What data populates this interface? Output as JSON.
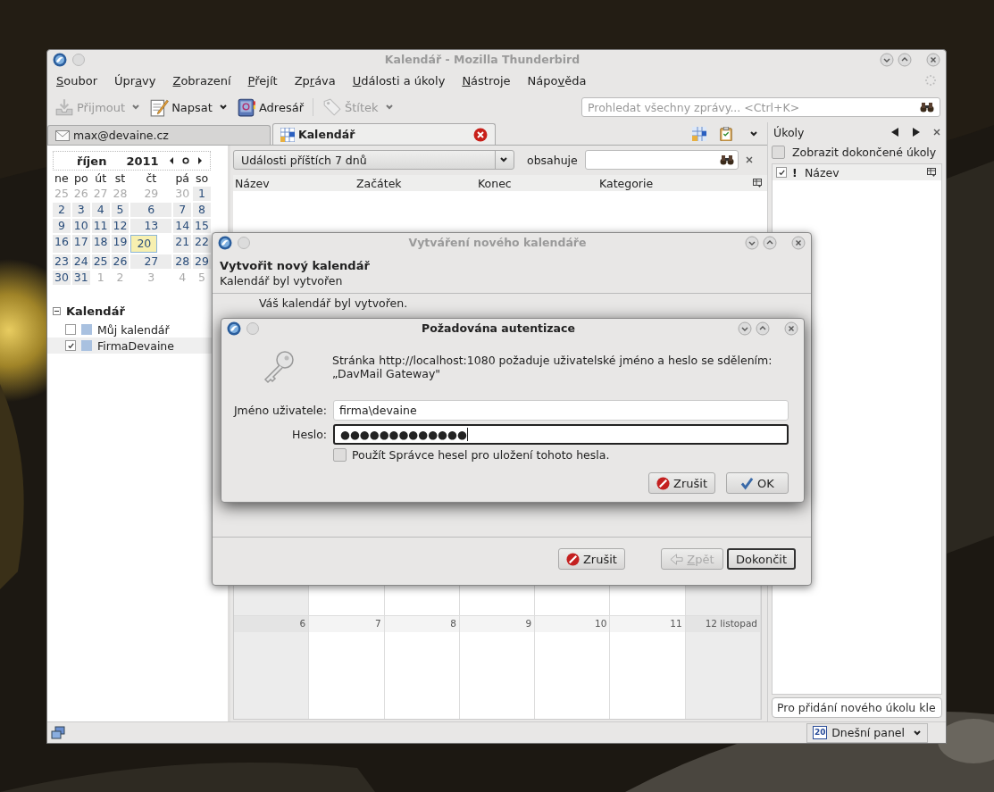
{
  "main_window": {
    "title": "Kalendář - Mozilla Thunderbird",
    "menu": [
      {
        "key": "S",
        "post": "oubor"
      },
      {
        "pre": "Úpr",
        "key": "a",
        "post": "vy"
      },
      {
        "key": "Z",
        "post": "obrazení"
      },
      {
        "key": "P",
        "post": "řejít"
      },
      {
        "pre": "Zp",
        "key": "r",
        "post": "áva"
      },
      {
        "key": "U",
        "post": "dálosti a úkoly"
      },
      {
        "key": "N",
        "post": "ástroje"
      },
      {
        "pre": "Nápo",
        "key": "v",
        "post": "ěda"
      }
    ],
    "toolbar": [
      {
        "label": "Přijmout",
        "kind": "inbox",
        "disabled": true,
        "dropdown": true
      },
      {
        "label": "Napsat",
        "kind": "compose",
        "disabled": false,
        "dropdown": true
      },
      {
        "label": "Adresář",
        "kind": "addressbook",
        "disabled": false,
        "dropdown": false
      },
      {
        "label": "Štítek",
        "kind": "tag",
        "disabled": true,
        "dropdown": true
      }
    ],
    "search": {
      "placeholder": "Prohledat všechny zprávy... <Ctrl+K>"
    },
    "tabs": [
      {
        "label": "max@devaine.cz",
        "kind": "mail",
        "selected": false,
        "closable": false
      },
      {
        "label": "Kalendář",
        "kind": "calendar",
        "selected": true,
        "closable": true
      }
    ],
    "filter": {
      "value": "Události příštích 7 dnů",
      "contains_label": "obsahuje"
    },
    "columns": [
      "Název",
      "Začátek",
      "Konec",
      "Kategorie"
    ],
    "minical": {
      "month": "říjen",
      "year": "2011",
      "weekdays": [
        "ne",
        "po",
        "út",
        "st",
        "čt",
        "pá",
        "so"
      ],
      "weeks": [
        [
          {
            "label": "25",
            "other_month": true,
            "selected": false
          },
          {
            "label": "26",
            "other_month": true,
            "selected": false
          },
          {
            "label": "27",
            "other_month": true,
            "selected": false
          },
          {
            "label": "28",
            "other_month": true,
            "selected": false
          },
          {
            "label": "29",
            "other_month": true,
            "selected": false
          },
          {
            "label": "30",
            "other_month": true,
            "selected": false
          },
          {
            "label": "1",
            "other_month": false,
            "selected": false
          }
        ],
        [
          {
            "label": "2",
            "other_month": false,
            "selected": false
          },
          {
            "label": "3",
            "other_month": false,
            "selected": false
          },
          {
            "label": "4",
            "other_month": false,
            "selected": false
          },
          {
            "label": "5",
            "other_month": false,
            "selected": false
          },
          {
            "label": "6",
            "other_month": false,
            "selected": false
          },
          {
            "label": "7",
            "other_month": false,
            "selected": false
          },
          {
            "label": "8",
            "other_month": false,
            "selected": false
          }
        ],
        [
          {
            "label": "9",
            "other_month": false,
            "selected": false
          },
          {
            "label": "10",
            "other_month": false,
            "selected": false
          },
          {
            "label": "11",
            "other_month": false,
            "selected": false
          },
          {
            "label": "12",
            "other_month": false,
            "selected": false
          },
          {
            "label": "13",
            "other_month": false,
            "selected": false
          },
          {
            "label": "14",
            "other_month": false,
            "selected": false
          },
          {
            "label": "15",
            "other_month": false,
            "selected": false
          }
        ],
        [
          {
            "label": "16",
            "other_month": false,
            "selected": false
          },
          {
            "label": "17",
            "other_month": false,
            "selected": false
          },
          {
            "label": "18",
            "other_month": false,
            "selected": false
          },
          {
            "label": "19",
            "other_month": false,
            "selected": false
          },
          {
            "label": "20",
            "other_month": false,
            "selected": true
          },
          {
            "label": "21",
            "other_month": false,
            "selected": false
          },
          {
            "label": "22",
            "other_month": false,
            "selected": false
          }
        ],
        [
          {
            "label": "23",
            "other_month": false,
            "selected": false
          },
          {
            "label": "24",
            "other_month": false,
            "selected": false
          },
          {
            "label": "25",
            "other_month": false,
            "selected": false
          },
          {
            "label": "26",
            "other_month": false,
            "selected": false
          },
          {
            "label": "27",
            "other_month": false,
            "selected": false
          },
          {
            "label": "28",
            "other_month": false,
            "selected": false
          },
          {
            "label": "29",
            "other_month": false,
            "selected": false
          }
        ],
        [
          {
            "label": "30",
            "other_month": false,
            "selected": false
          },
          {
            "label": "31",
            "other_month": false,
            "selected": false
          },
          {
            "label": "1",
            "other_month": true,
            "selected": false
          },
          {
            "label": "2",
            "other_month": true,
            "selected": false
          },
          {
            "label": "3",
            "other_month": true,
            "selected": false
          },
          {
            "label": "4",
            "other_month": true,
            "selected": false
          },
          {
            "label": "5",
            "other_month": true,
            "selected": false
          }
        ]
      ]
    },
    "calendars": {
      "heading": "Kalendář",
      "expanded": true,
      "items": [
        {
          "name": "Můj kalendář",
          "checked": false,
          "selected": false,
          "color": "#a9c1e0"
        },
        {
          "name": "FirmaDevaine",
          "checked": true,
          "selected": true,
          "color": "#a9c1e0"
        }
      ]
    },
    "month_view": {
      "day_labels": [
        "6",
        "7",
        "8",
        "9",
        "10",
        "11",
        "12 listopad"
      ]
    },
    "tasks": {
      "title": "Úkoly",
      "show_completed": {
        "label": "Zobrazit dokončené úkoly",
        "checked": false
      },
      "column_done": true,
      "column_priority": "!",
      "column_name": "Název",
      "new_task_placeholder": "Pro přidání nového úkolu kle"
    },
    "status_bar": {
      "today_pane": {
        "label": "Dnešní panel",
        "day": "20"
      }
    }
  },
  "wizard": {
    "title": "Vytváření nového kalendáře",
    "heading": "Vytvořit nový kalendář",
    "subtitle": "Kalendář byl vytvořen",
    "message": "Váš kalendář byl vytvořen.",
    "buttons": [
      {
        "label": "Zrušit",
        "kind": "cancel",
        "disabled": false,
        "default": false
      },
      {
        "key": "Z",
        "post": "pět",
        "kind": "back",
        "disabled": true,
        "default": false
      },
      {
        "label": "Dokončit",
        "kind": "finish",
        "disabled": false,
        "default": true
      }
    ]
  },
  "auth": {
    "title": "Požadována autentizace",
    "message": [
      "Stránka http://localhost:1080 požaduje uživatelské jméno a heslo se sdělením:",
      "„DavMail Gateway\""
    ],
    "fields": [
      {
        "label": "Jméno uživatele:",
        "value": "firma\\devaine",
        "focused": false
      },
      {
        "label": "Heslo:",
        "value": "●●●●●●●●●●●●●",
        "focused": true
      }
    ],
    "save_password": {
      "label": "Použít Správce hesel pro uložení tohoto hesla.",
      "checked": false
    },
    "buttons": [
      {
        "label": "Zrušit",
        "kind": "cancel",
        "default": false
      },
      {
        "label": "OK",
        "kind": "ok",
        "default": false
      }
    ]
  }
}
